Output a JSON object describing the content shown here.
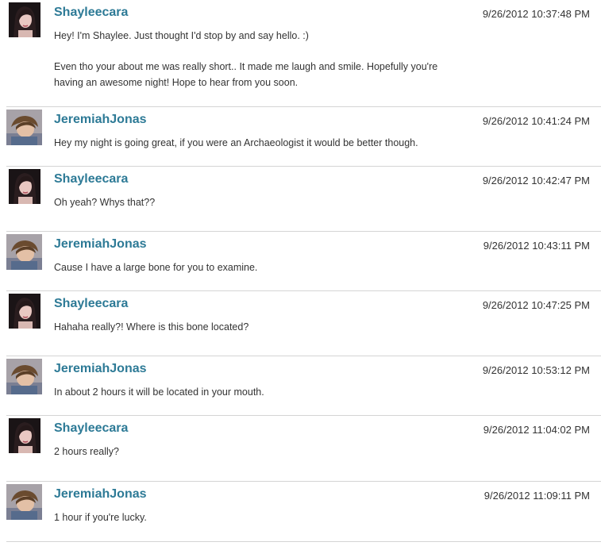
{
  "messages": [
    {
      "user": "Shayleecara",
      "time": "9/26/2012 10:37:48 PM",
      "text": [
        "Hey! I'm Shaylee. Just thought I'd stop by and say hello. :)",
        "Even tho your about me was really short.. It made me laugh and smile. Hopefully you're having an awesome night! Hope to hear from you soon."
      ]
    },
    {
      "user": "JeremiahJonas",
      "time": "9/26/2012 10:41:24 PM",
      "text": [
        "Hey my night is going great, if you were an Archaeologist it would be better though."
      ]
    },
    {
      "user": "Shayleecara",
      "time": "9/26/2012 10:42:47 PM",
      "text": [
        "Oh yeah? Whys that??"
      ]
    },
    {
      "user": "JeremiahJonas",
      "time": "9/26/2012 10:43:11 PM",
      "text": [
        "Cause I have a large bone for you to examine."
      ]
    },
    {
      "user": "Shayleecara",
      "time": "9/26/2012 10:47:25 PM",
      "text": [
        "Hahaha really?! Where is this bone located?"
      ]
    },
    {
      "user": "JeremiahJonas",
      "time": "9/26/2012 10:53:12 PM",
      "text": [
        "In about 2 hours it will be located in your mouth."
      ]
    },
    {
      "user": "Shayleecara",
      "time": "9/26/2012 11:04:02 PM",
      "text": [
        "2 hours really?"
      ]
    },
    {
      "user": "JeremiahJonas",
      "time": "9/26/2012 11:09:11 PM",
      "text": [
        "1 hour if you're lucky."
      ]
    }
  ],
  "colors": {
    "username": "#2d7a96",
    "text": "#333333",
    "divider": "#d4d4d4"
  }
}
